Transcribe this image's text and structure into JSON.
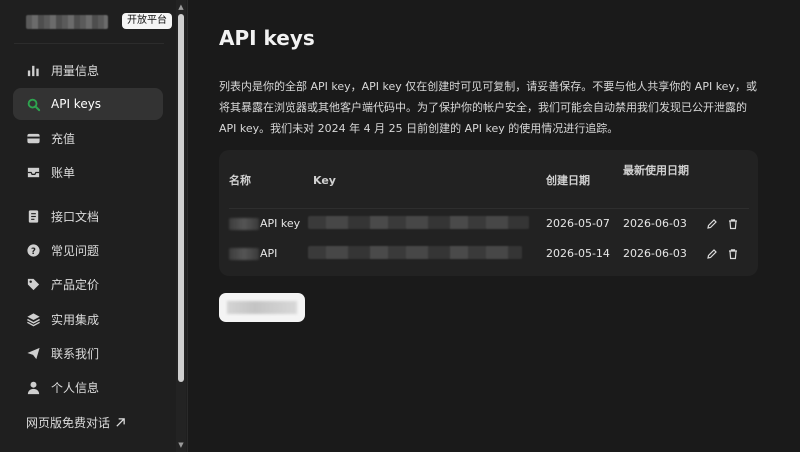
{
  "sidebar": {
    "badge": "开放平台",
    "items": [
      {
        "label": "用量信息",
        "icon": "bar-chart-icon"
      },
      {
        "label": "API keys",
        "icon": "search-icon",
        "active": true
      },
      {
        "label": "充值",
        "icon": "wallet-icon"
      },
      {
        "label": "账单",
        "icon": "inbox-icon"
      },
      {
        "label": "接口文档",
        "icon": "document-icon"
      },
      {
        "label": "常见问题",
        "icon": "question-icon"
      },
      {
        "label": "产品定价",
        "icon": "tag-icon"
      },
      {
        "label": "实用集成",
        "icon": "layers-icon"
      },
      {
        "label": "联系我们",
        "icon": "send-icon"
      },
      {
        "label": "个人信息",
        "icon": "user-icon"
      }
    ],
    "footer_link": "网页版免费对话",
    "accent_color": "#2ea44f"
  },
  "main": {
    "title": "API keys",
    "description": "列表内是你的全部 API key，API key 仅在创建时可见可复制，请妥善保存。不要与他人共享你的 API key，或将其暴露在浏览器或其他客户端代码中。为了保护你的帐户安全，我们可能会自动禁用我们发现已公开泄露的 API key。我们未对 2024 年 4 月 25 日前创建的 API key 的使用情况进行追踪。",
    "table": {
      "headers": {
        "name": "名称",
        "key": "Key",
        "created": "创建日期",
        "last_used": "最新使用日期"
      },
      "rows": [
        {
          "name_suffix": "API key",
          "created": "2026-05-07",
          "last_used": "2026-06-03"
        },
        {
          "name_suffix": "API",
          "created": "2026-05-14",
          "last_used": "2026-06-03"
        }
      ]
    }
  }
}
